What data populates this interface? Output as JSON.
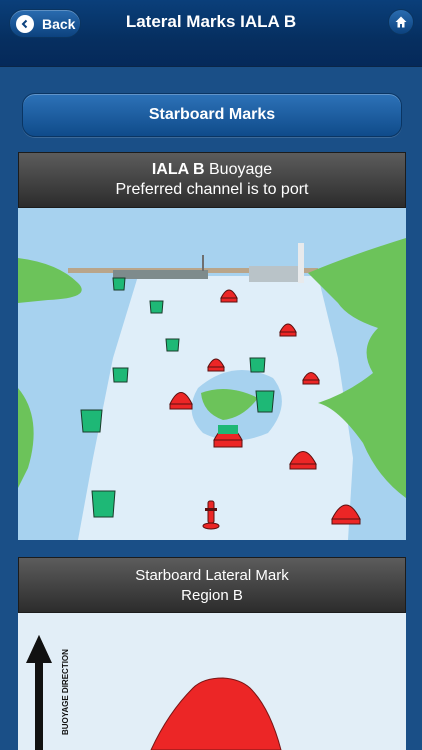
{
  "navbar": {
    "back_label": "Back",
    "title": "Lateral Marks IALA B"
  },
  "section_button": {
    "label": "Starboard Marks"
  },
  "panel1": {
    "title_bold": "IALA  B",
    "title_rest": "  Buoyage",
    "subtitle": "Preferred channel is to port"
  },
  "panel2": {
    "title": "Starboard Lateral Mark",
    "subtitle": "Region B"
  },
  "detail": {
    "arrow_label": "BUOYAGE DIRECTION"
  },
  "colors": {
    "starboard_red": "#ec2626",
    "port_green": "#1eb876",
    "land_green": "#6cc35a",
    "water_blue": "#a7d2ef"
  }
}
